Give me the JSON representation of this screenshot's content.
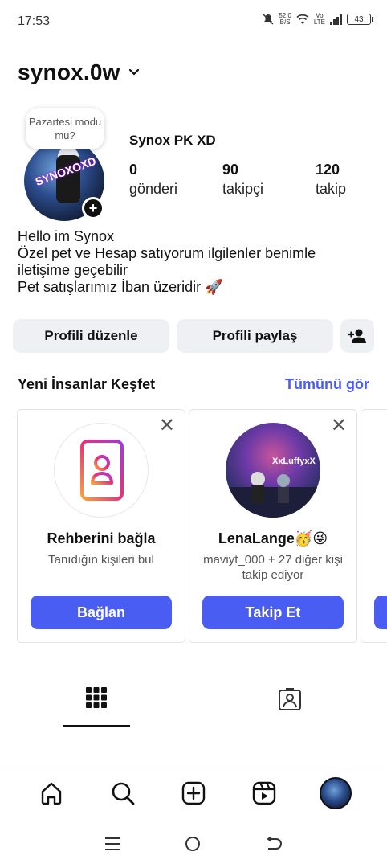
{
  "status_bar": {
    "time": "17:53",
    "net_speed": "52,0",
    "net_unit": "B/S",
    "vo": "Vo",
    "lte": "LTE",
    "battery": "43"
  },
  "profile": {
    "username": "synox.0w",
    "note": "Pazartesi modu mu?",
    "display_name": "Synox PK XD",
    "stats": [
      {
        "value": "0",
        "label": "gönderi"
      },
      {
        "value": "90",
        "label": "takipçi"
      },
      {
        "value": "120",
        "label": "takip"
      }
    ],
    "bio": [
      "Hello im Synox",
      "Özel pet ve Hesap satıyorum ilgilenler benimle",
      "iletişime geçebilir",
      "Pet satışlarımız İban üzeridir 🚀"
    ]
  },
  "buttons": {
    "edit_profile": "Profili düzenle",
    "share_profile": "Profili paylaş"
  },
  "discover": {
    "title": "Yeni İnsanlar Keşfet",
    "see_all": "Tümünü gör",
    "cards": [
      {
        "name": "Rehberini bağla",
        "subtitle": "Tanıdığın kişileri bul",
        "action": "Bağlan"
      },
      {
        "name": "LenaLange🥳😜",
        "subtitle": "maviyt_000 + 27 diğer kişi takip ediyor",
        "action": "Takip Et",
        "avatar_text": "XxLuffyxX"
      }
    ]
  },
  "colors": {
    "accent": "#4a5df2",
    "button_bg": "#eef0f4"
  },
  "icons": {
    "chevron": "chevron-down-icon",
    "add_user": "person-add-icon",
    "tab_grid": "grid-icon",
    "tab_tagged": "tagged-icon",
    "nav": [
      "home-icon",
      "search-icon",
      "create-icon",
      "reels-icon",
      "profile-avatar"
    ],
    "system_nav": [
      "menu-icon",
      "home-circle-icon",
      "back-icon"
    ]
  }
}
